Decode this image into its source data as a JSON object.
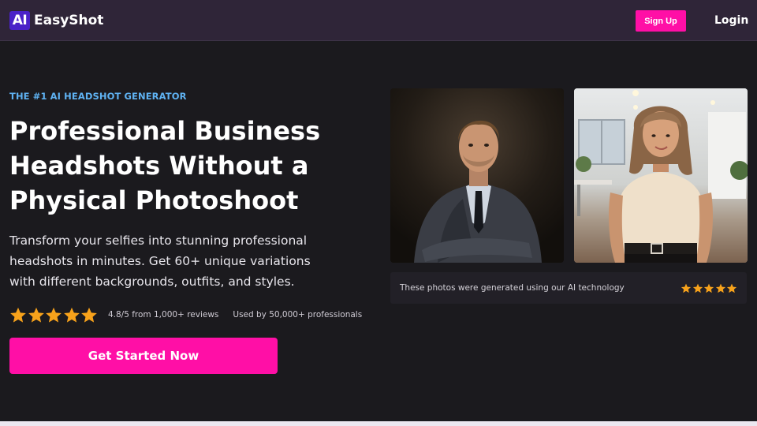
{
  "header": {
    "logo_mark": "AI",
    "logo_text": "EasyShot",
    "signup_label": "Sign Up",
    "login_label": "Login"
  },
  "hero": {
    "eyebrow": "THE #1 AI HEADSHOT GENERATOR",
    "headline_lines": [
      "Professional Business",
      "Headshots Without a",
      "Physical Photoshoot"
    ],
    "subtext_lines": [
      "Transform your selfies into stunning professional",
      "headshots in minutes. Get 60+ unique variations",
      "with different backgrounds, outfits, and styles."
    ],
    "rating": {
      "stars": 5,
      "text": "4.8/5 from 1,000+ reviews",
      "users_text": "Used by 50,000+ professionals"
    },
    "cta_label": "Get Started Now"
  },
  "gallery": {
    "caption": "These photos were generated using our AI technology",
    "stars": 5
  },
  "colors": {
    "accent": "#ff0fa6",
    "header_bg": "#2f2538",
    "page_bg": "#1b1a1e",
    "eyebrow": "#5fb2f2",
    "star": "#f7a21b",
    "logo_mark_bg": "#4a21c8"
  },
  "icons": {
    "star": "star-icon",
    "logo": "logo-ai-icon"
  }
}
